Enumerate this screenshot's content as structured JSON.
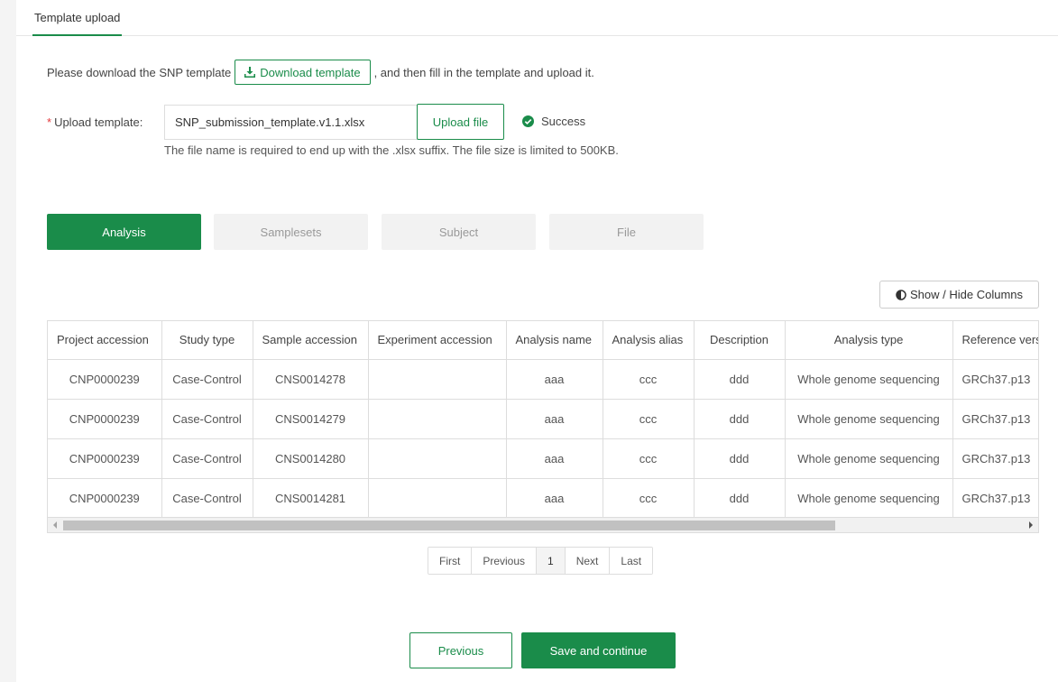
{
  "tabs": {
    "active_label": "Template upload"
  },
  "instruction": {
    "before": "Please download the SNP template",
    "download_label": "Download template",
    "after": ", and then fill in the template and upload it."
  },
  "upload": {
    "required_mark": "*",
    "label": "Upload template:",
    "file_name": "SNP_submission_template.v1.1.xlsx",
    "button_label": "Upload file",
    "status": "Success",
    "hint": "The file name is required to end up with the .xlsx suffix. The file size is limited to 500KB."
  },
  "subtabs": [
    {
      "label": "Analysis",
      "active": true
    },
    {
      "label": "Samplesets",
      "active": false
    },
    {
      "label": "Subject",
      "active": false
    },
    {
      "label": "File",
      "active": false
    }
  ],
  "columns_button": "Show / Hide Columns",
  "table": {
    "headers": [
      "Project accession",
      "Study type",
      "Sample accession",
      "Experiment accession",
      "Analysis name",
      "Analysis alias",
      "Description",
      "Analysis type",
      "Reference version"
    ],
    "rows": [
      [
        "CNP0000239",
        "Case-Control",
        "CNS0014278",
        "",
        "aaa",
        "ccc",
        "ddd",
        "Whole genome sequencing",
        "GRCh37.p13"
      ],
      [
        "CNP0000239",
        "Case-Control",
        "CNS0014279",
        "",
        "aaa",
        "ccc",
        "ddd",
        "Whole genome sequencing",
        "GRCh37.p13"
      ],
      [
        "CNP0000239",
        "Case-Control",
        "CNS0014280",
        "",
        "aaa",
        "ccc",
        "ddd",
        "Whole genome sequencing",
        "GRCh37.p13"
      ],
      [
        "CNP0000239",
        "Case-Control",
        "CNS0014281",
        "",
        "aaa",
        "ccc",
        "ddd",
        "Whole genome sequencing",
        "GRCh37.p13"
      ]
    ]
  },
  "pager": {
    "first": "First",
    "previous": "Previous",
    "current": "1",
    "next": "Next",
    "last": "Last"
  },
  "footer": {
    "previous_label": "Previous",
    "save_label": "Save and continue"
  },
  "colors": {
    "accent": "#1a8c4a",
    "required": "#e4393c"
  },
  "icons": {
    "download": "download-icon",
    "success": "check-circle-icon",
    "columns": "half-circle-icon"
  }
}
